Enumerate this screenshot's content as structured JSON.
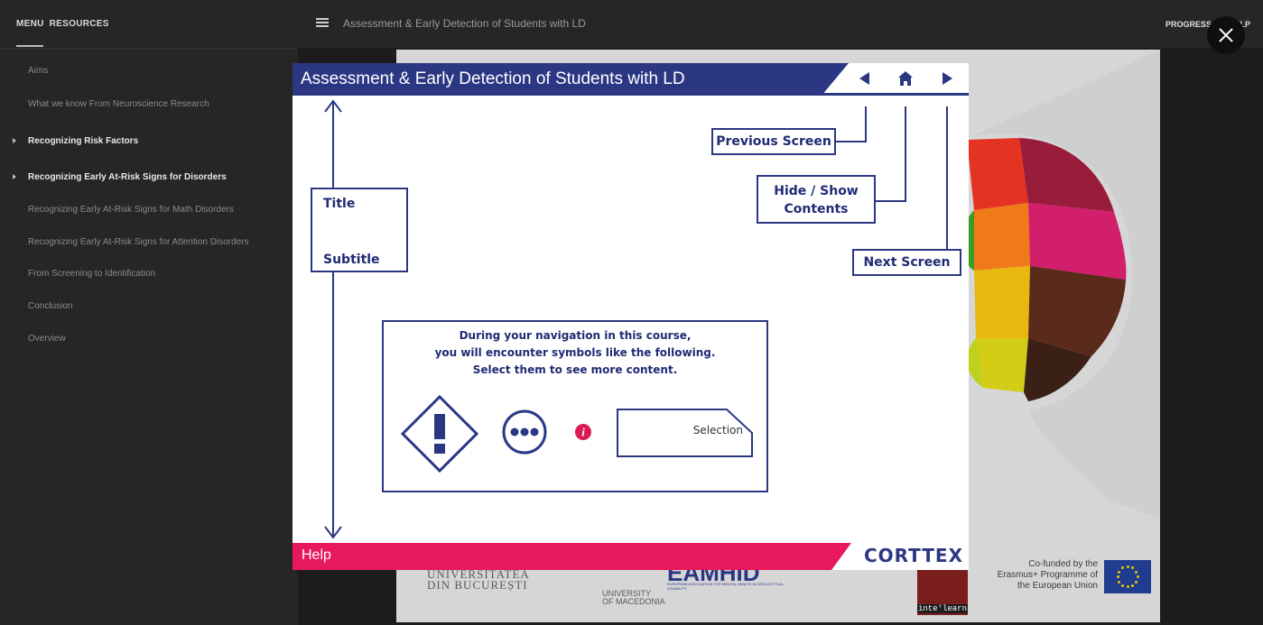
{
  "sidebar": {
    "tabs": [
      "MENU",
      "RESOURCES"
    ],
    "items": [
      {
        "label": "Aims",
        "bold": false,
        "expandable": false
      },
      {
        "label": "What we know From Neuroscience Research",
        "bold": false,
        "expandable": false
      },
      {
        "label": "Recognizing Risk Factors",
        "bold": true,
        "expandable": true
      },
      {
        "label": "Recognizing Early At-Risk Signs for Disorders",
        "bold": true,
        "expandable": true
      },
      {
        "label": "Recognizing Early At-Risk Signs for Math Disorders",
        "bold": false,
        "expandable": false
      },
      {
        "label": "Recognizing Early At-Risk Signs for Attention Disorders",
        "bold": false,
        "expandable": false
      },
      {
        "label": "From Screening to Identification",
        "bold": false,
        "expandable": false
      },
      {
        "label": "Conclusion",
        "bold": false,
        "expandable": false
      },
      {
        "label": "Overview",
        "bold": false,
        "expandable": false
      }
    ]
  },
  "topbar": {
    "title": "Assessment & Early Detection of Students with LD",
    "progress": "PROGRESS",
    "help": "HELP"
  },
  "modal": {
    "header_title": "Assessment & Early Detection of Students with LD",
    "callouts": {
      "previous": "Previous Screen",
      "hide_show": "Hide / Show\nContents",
      "next": "Next Screen",
      "title": "Title",
      "subtitle": "Subtitle"
    },
    "info_lines": [
      "During your navigation in this course,",
      "you will encounter symbols like the following.",
      "Select them to see more content."
    ],
    "selection_label": "Selection",
    "footer_help": "Help",
    "footer_logo": "CORTTEX"
  },
  "background": {
    "funding": "Co-funded by the Erasmus+ Programme of the European Union",
    "logo_ub": "DIN BUCUREȘTI",
    "logo_ub_top": "UNIVERSITATEA",
    "logo_macedonia_1": "UNIVERSITY",
    "logo_macedonia_2": "OF MACEDONIA",
    "logo_eamhid": "EAMHID",
    "logo_eamhid_sub": "EUROPEAN ASSOCIATION FOR MENTAL HEALTH IN INTELLECTUAL DISABILITY",
    "logo_intelearn": "inte'learn"
  },
  "colors": {
    "navy": "#2b3783",
    "pink": "#e8185d",
    "info_red": "#d81c52"
  }
}
